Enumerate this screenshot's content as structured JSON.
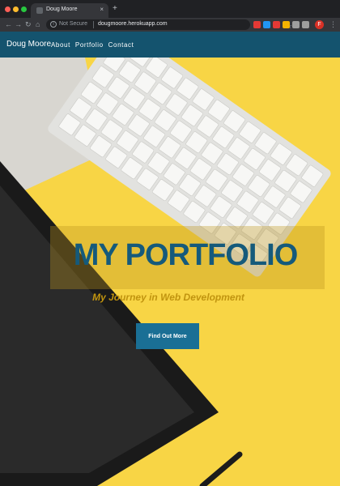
{
  "browser": {
    "tab_title": "Doug Moore",
    "tab_close": "×",
    "new_tab": "+",
    "nav": {
      "back": "←",
      "forward": "→",
      "reload": "↻",
      "home": "⌂"
    },
    "security_label": "Not Secure",
    "info_symbol": "i",
    "url": "dougmoore.herokuapp.com",
    "star": "☆",
    "profile_initial": "F",
    "menu": "⋮",
    "extension_colors": [
      "#e53935",
      "#2196f3",
      "#e53935",
      "#f4b400",
      "#9e9e9e",
      "#9e9e9e"
    ]
  },
  "site": {
    "brand": "Doug Moore",
    "nav_links": [
      "About",
      "Portfolio",
      "Contact"
    ],
    "hero": {
      "title": "MY PORTFOLIO",
      "subtitle": "My Journey in Web Development",
      "button_label": "Find Out More"
    },
    "colors": {
      "navbar": "#14536e",
      "title": "#155a7b",
      "subtitle": "#c1940f",
      "button": "#1a6f95",
      "background": "#f8d545"
    }
  }
}
